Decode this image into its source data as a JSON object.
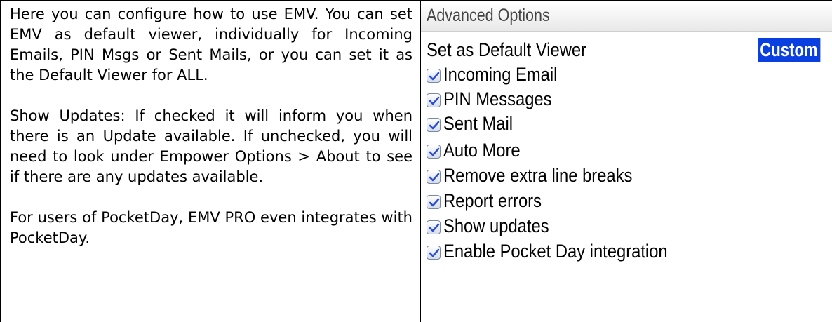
{
  "help": {
    "p1": "Here you can configure how to use EMV. You can set EMV as default viewer, individually for Incoming Emails, PIN Msgs or Sent Mails, or you can set it as the Default Viewer for ALL.",
    "p2": "Show Updates: If checked it will inform you when there is an Update available. If unchecked, you will need to look under Empower Options > About to see if there are any updates available.",
    "p3": "For users of PocketDay, EMV PRO even integrates with PocketDay."
  },
  "screen": {
    "title": "Advanced Options",
    "default_viewer": {
      "label": "Set as Default Viewer",
      "value": "Custom"
    },
    "checkboxes": [
      {
        "label": "Incoming Email",
        "checked": true
      },
      {
        "label": "PIN Messages",
        "checked": true
      },
      {
        "label": "Sent Mail",
        "checked": true
      },
      {
        "label": "Auto More",
        "checked": true
      },
      {
        "label": "Remove extra line breaks",
        "checked": true
      },
      {
        "label": "Report errors",
        "checked": true
      },
      {
        "label": "Show updates",
        "checked": true
      },
      {
        "label": "Enable Pocket Day integration",
        "checked": true
      }
    ]
  },
  "colors": {
    "highlight": "#0a3fe0",
    "check": "#2a4fd0"
  }
}
